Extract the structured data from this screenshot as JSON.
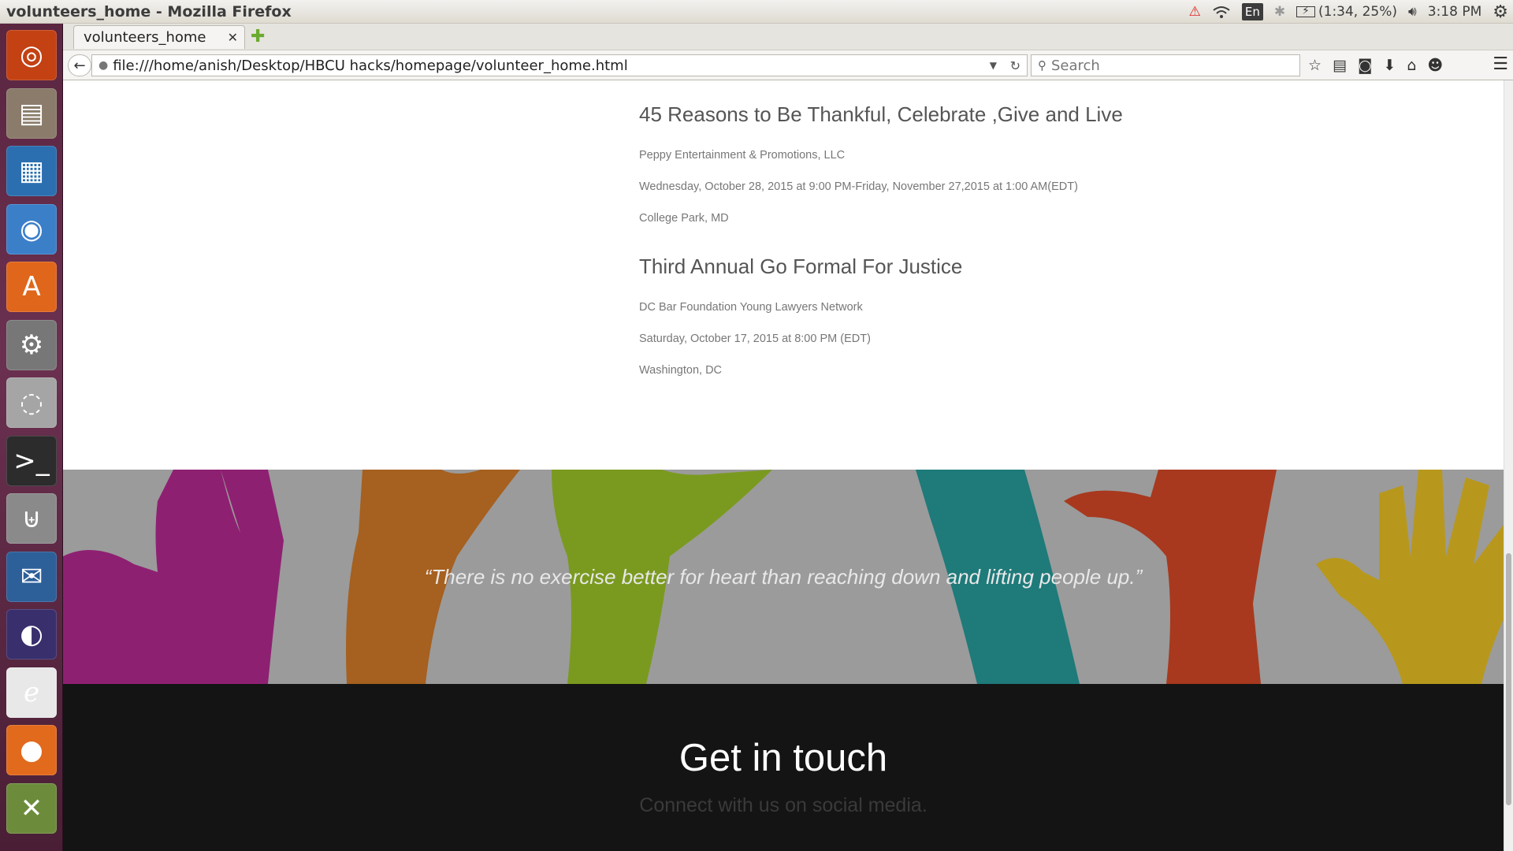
{
  "window": {
    "title": "volunteers_home - Mozilla Firefox"
  },
  "indicators": {
    "keyboard": "En",
    "battery": "(1:34, 25%)",
    "time": "3:18 PM"
  },
  "launcher": {
    "items": [
      {
        "name": "ubuntu-dash-icon",
        "glyph": "◎",
        "color": "#c34113"
      },
      {
        "name": "files-icon",
        "glyph": "▤",
        "color": "#8a7b6a"
      },
      {
        "name": "libreoffice-impress-icon",
        "glyph": "▦",
        "color": "#2b6fb0"
      },
      {
        "name": "chromium-icon",
        "glyph": "◉",
        "color": "#3b7fc9"
      },
      {
        "name": "software-center-icon",
        "glyph": "A",
        "color": "#e0661b"
      },
      {
        "name": "system-settings-icon",
        "glyph": "⚙",
        "color": "#777"
      },
      {
        "name": "disk-icon",
        "glyph": "◌",
        "color": "#a5a5a5"
      },
      {
        "name": "terminal-icon",
        "glyph": ">_",
        "color": "#2c2c2c"
      },
      {
        "name": "usb-creator-icon",
        "glyph": "⊎",
        "color": "#8a8a8a"
      },
      {
        "name": "thunderbird-icon",
        "glyph": "✉",
        "color": "#2d5f99"
      },
      {
        "name": "eclipse-icon",
        "glyph": "◐",
        "color": "#3a2f6d"
      },
      {
        "name": "evince-icon",
        "glyph": "ℯ",
        "color": "#e8e8e8"
      },
      {
        "name": "firefox-icon",
        "glyph": "●",
        "color": "#e26a1d"
      },
      {
        "name": "app-icon",
        "glyph": "✕",
        "color": "#6c8c3c"
      }
    ]
  },
  "browser": {
    "tab_label": "volunteers_home",
    "url": "file:///home/anish/Desktop/HBCU hacks/homepage/volunteer_home.html",
    "search_placeholder": "Search"
  },
  "events": [
    {
      "title": "45 Reasons to Be Thankful, Celebrate ,Give and Live",
      "organizer": "Peppy Entertainment & Promotions, LLC",
      "date": "Wednesday, October 28, 2015 at 9:00 PM-Friday, November 27,2015 at 1:00 AM(EDT)",
      "location": "College Park, MD"
    },
    {
      "title": "Third Annual Go Formal For Justice",
      "organizer": "DC Bar Foundation Young Lawyers Network",
      "date": "Saturday, October 17, 2015 at 8:00 PM (EDT)",
      "location": "Washington, DC"
    }
  ],
  "banner": {
    "quote": "“There is no exercise better for heart than reaching down and lifting people up.”",
    "colors": [
      "#8e2072",
      "#a6601f",
      "#7a9a1f",
      "#1f7a7a",
      "#a8391e",
      "#b8981c"
    ]
  },
  "footer": {
    "title": "Get in touch",
    "subtitle": "Connect with us on social media."
  }
}
